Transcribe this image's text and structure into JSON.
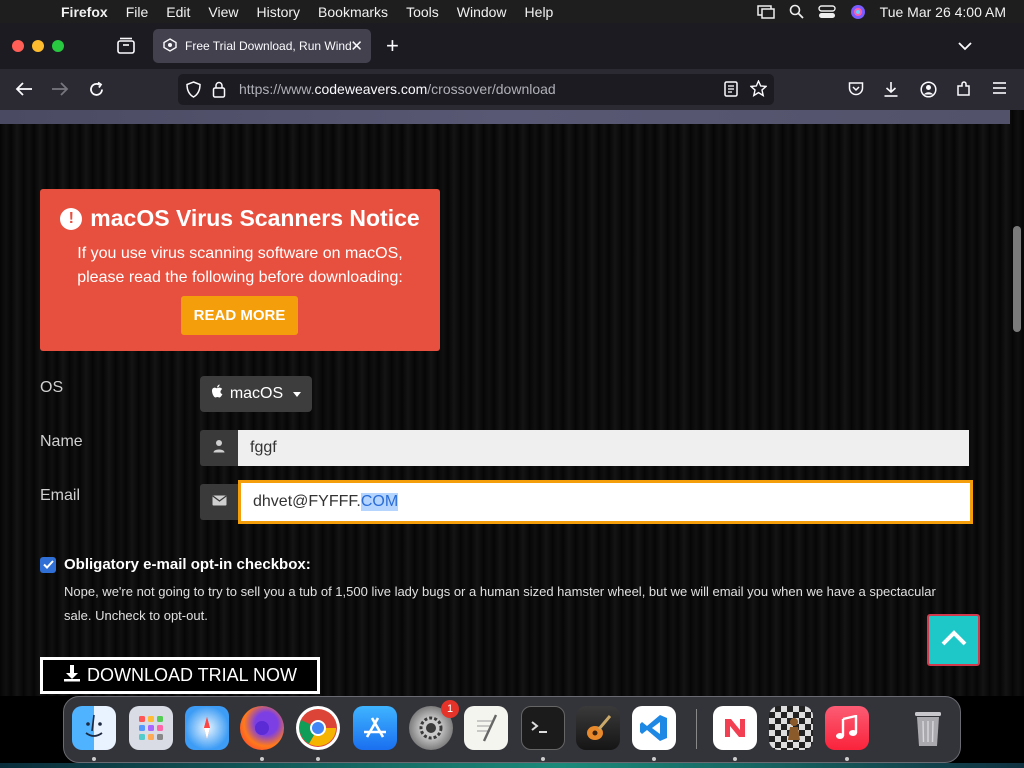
{
  "menubar": {
    "app_name": "Firefox",
    "items": [
      "File",
      "Edit",
      "View",
      "History",
      "Bookmarks",
      "Tools",
      "Window",
      "Help"
    ],
    "datetime": "Tue Mar 26  4:00 AM"
  },
  "browser": {
    "tab_title": "Free Trial Download, Run Windo",
    "url_prefix": "https://www.",
    "url_domain": "codeweavers.com",
    "url_path": "/crossover/download"
  },
  "notice": {
    "title": "macOS Virus Scanners Notice",
    "line1": "If you use virus scanning software on macOS,",
    "line2": "please read the following before downloading:",
    "button": "READ MORE"
  },
  "form": {
    "os_label": "OS",
    "os_value": "macOS",
    "name_label": "Name",
    "name_value": "fggf",
    "email_label": "Email",
    "email_value_plain": "dhvet@FYFFF.",
    "email_value_selected": "COM",
    "optin_title": "Obligatory e-mail opt-in checkbox:",
    "optin_line1": "Nope, we're not going to try to sell you a tub of 1,500 live lady bugs or a human sized hamster wheel, but we will email you when we have a spectacular",
    "optin_line2": "sale. Uncheck to opt-out.",
    "optin_checked": true,
    "download_button": "DOWNLOAD TRIAL NOW"
  },
  "dock": {
    "apps": [
      "Finder",
      "Launchpad",
      "Safari",
      "Firefox",
      "Chrome",
      "App Store",
      "System Settings",
      "TextEdit",
      "Terminal",
      "GarageBand",
      "VS Code",
      "News",
      "Chess",
      "Music",
      "Trash"
    ],
    "settings_badge": "1"
  },
  "colors": {
    "notice_bg": "#e7503f",
    "accent_orange": "#f59e0b",
    "checkbox_blue": "#2f6fd6",
    "totop_teal": "#1ec8c8"
  }
}
